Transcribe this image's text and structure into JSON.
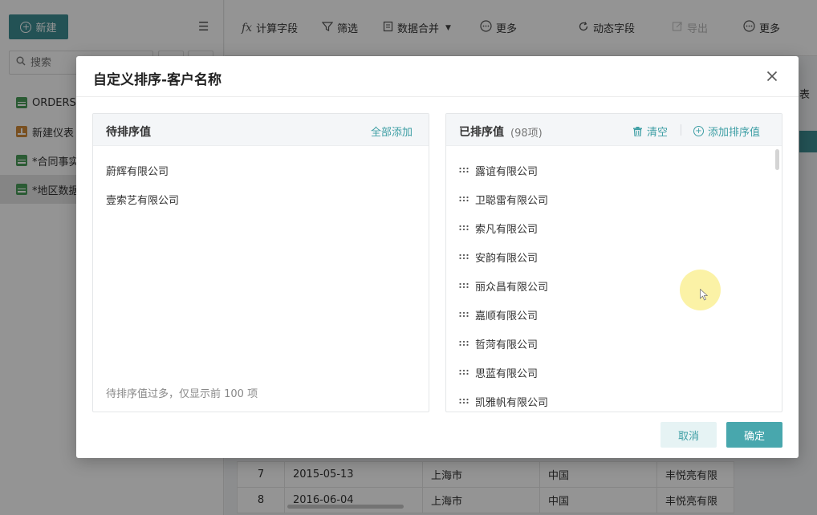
{
  "sidebar": {
    "new_button": "新建",
    "search_placeholder": "搜索",
    "items": [
      {
        "label": "ORDERS",
        "icon": "table-icon",
        "active": false
      },
      {
        "label": "新建仪表",
        "icon": "dashboard-icon",
        "active": false
      },
      {
        "label": "*合同事实",
        "icon": "table-icon",
        "active": false
      },
      {
        "label": "*地区数据",
        "icon": "table-icon",
        "active": true
      }
    ]
  },
  "toolbar": {
    "calc_field": "计算字段",
    "filter": "筛选",
    "data_merge": "数据合并",
    "more1": "更多",
    "dynamic_field": "动态字段",
    "export": "导出",
    "more2": "更多"
  },
  "background": {
    "right_fragment": "表",
    "rows": [
      {
        "n": "7",
        "date": "2015-05-13",
        "city": "上海市",
        "country": "中国",
        "company": "丰悦亮有限"
      },
      {
        "n": "8",
        "date": "2016-06-04",
        "city": "上海市",
        "country": "中国",
        "company": "丰悦亮有限"
      }
    ]
  },
  "modal": {
    "title": "自定义排序-客户名称",
    "left": {
      "title": "待排序值",
      "add_all": "全部添加",
      "items": [
        "蔚辉有限公司",
        "壹索艺有限公司"
      ],
      "note": "待排序值过多，仅显示前 100 项"
    },
    "right": {
      "title": "已排序值",
      "count": "(98项)",
      "clear": "清空",
      "add_sort": "添加排序值",
      "items": [
        "露谊有限公司",
        "卫聪雷有限公司",
        "索凡有限公司",
        "安韵有限公司",
        "丽众昌有限公司",
        "嘉顺有限公司",
        "哲菏有限公司",
        "思蓝有限公司",
        "凯雅帆有限公司"
      ]
    },
    "cancel": "取消",
    "confirm": "确定"
  },
  "colors": {
    "accent": "#48a7ad",
    "link": "#3d9ea4",
    "brand_dark": "#3d8e93"
  }
}
